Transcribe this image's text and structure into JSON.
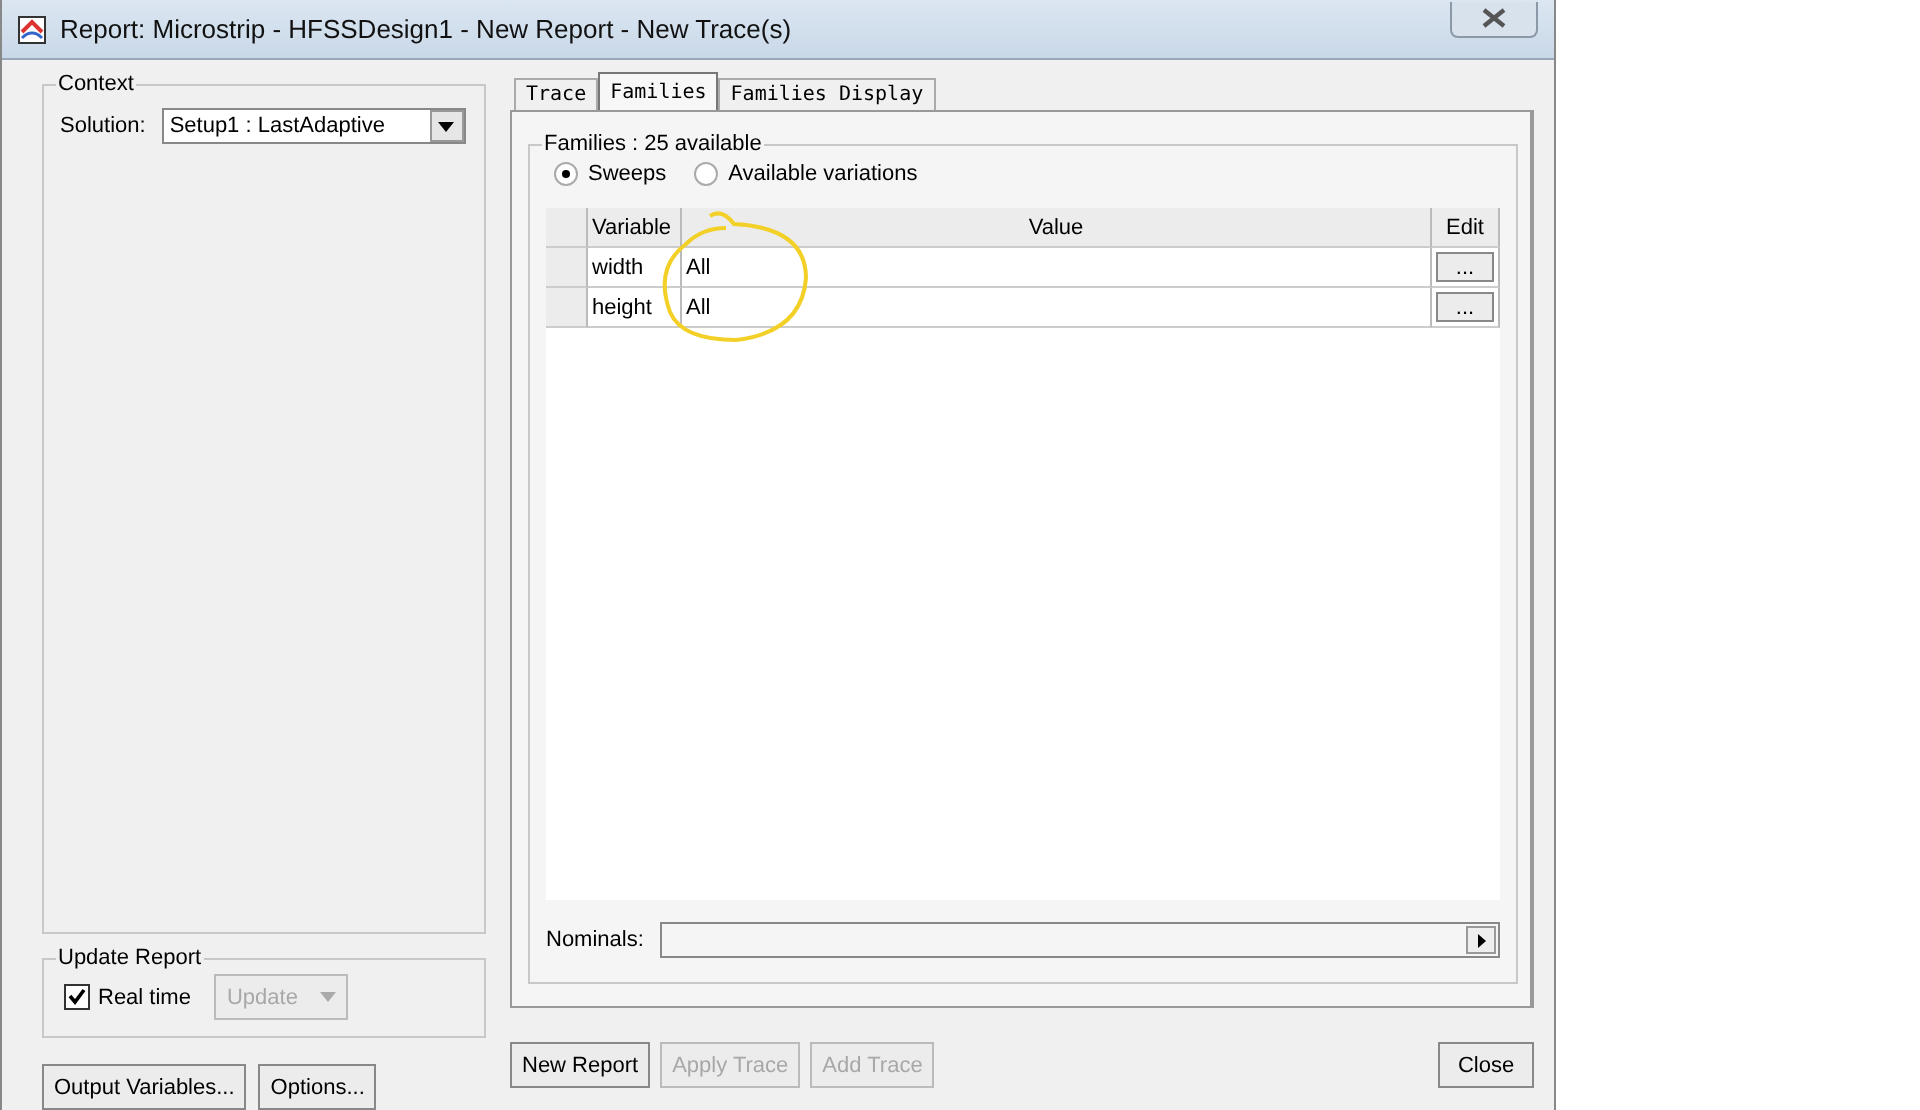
{
  "window": {
    "title": "Report: Microstrip - HFSSDesign1 - New Report - New Trace(s)"
  },
  "context": {
    "label": "Context",
    "solution_label": "Solution:",
    "solution": "Setup1 : LastAdaptive"
  },
  "update_report": {
    "label": "Update Report",
    "real_time": {
      "label": "Real time",
      "checked": true
    },
    "update_button": {
      "label": "Update",
      "disabled": true
    }
  },
  "left_buttons": [
    {
      "label": "Output Variables...",
      "disabled": false
    },
    {
      "label": "Options...",
      "disabled": false
    }
  ],
  "tabs": [
    {
      "label": "Trace",
      "selected": false
    },
    {
      "label": "Families",
      "selected": true
    },
    {
      "label": "Families Display",
      "selected": false
    }
  ],
  "families": {
    "label": "Families : 25 available",
    "modes": [
      {
        "label": "Sweeps",
        "selected": true
      },
      {
        "label": "Available variations",
        "selected": false
      }
    ],
    "columns": [
      "Variable",
      "Value",
      "Edit"
    ],
    "rows": [
      {
        "variable": "width",
        "value": "All",
        "edit": "..."
      },
      {
        "variable": "height",
        "value": "All",
        "edit": "..."
      }
    ]
  },
  "nominals_label": "Nominals:",
  "buttons": [
    {
      "label": "New Report",
      "disabled": false
    },
    {
      "label": "Apply Trace",
      "disabled": true
    },
    {
      "label": "Add Trace",
      "disabled": true
    }
  ],
  "close_button": "Close"
}
